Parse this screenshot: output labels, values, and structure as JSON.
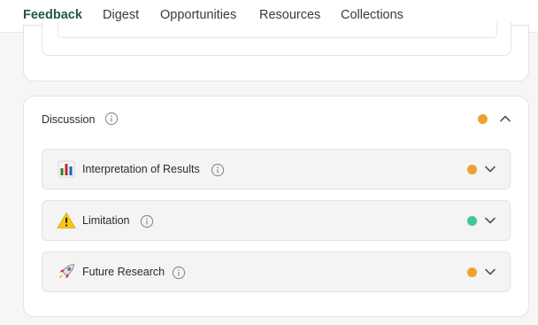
{
  "tabs": [
    {
      "label": "Feedback",
      "active": true
    },
    {
      "label": "Digest",
      "active": false
    },
    {
      "label": "Opportunities",
      "active": false
    },
    {
      "label": "Resources",
      "active": false
    },
    {
      "label": "Collections",
      "active": false
    }
  ],
  "discussion": {
    "title": "Discussion",
    "status_color": "#f0a030",
    "expanded": true,
    "items": [
      {
        "label": "Interpretation of Results",
        "icon": "bar-chart-icon",
        "status_color": "#f0a030"
      },
      {
        "label": "Limitation",
        "icon": "warning-icon",
        "status_color": "#3cc7a0"
      },
      {
        "label": "Future Research",
        "icon": "rocket-icon",
        "status_color": "#f0a030"
      }
    ]
  },
  "colors": {
    "accent": "#1f5c3d",
    "orange": "#f0a030",
    "teal": "#3cc7a0"
  }
}
